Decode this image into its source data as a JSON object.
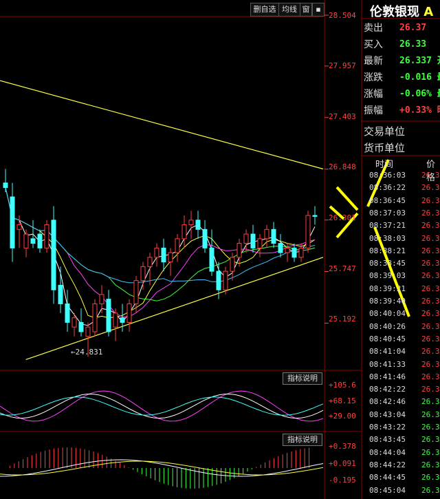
{
  "toolbar": {
    "delete_watch": "删自选",
    "ma_line": "均线",
    "window": "窗"
  },
  "title": "伦敦银现",
  "title_suffix": "A",
  "price_axis": [
    "28.504",
    "27.957",
    "27.403",
    "26.848",
    "26.301",
    "25.747",
    "25.192"
  ],
  "low_marker": "24.831",
  "indicator1": {
    "button": "指标说明",
    "levels": [
      "+105.6",
      "+68.15",
      "+29.00"
    ]
  },
  "indicator2": {
    "button": "指标说明",
    "levels": [
      "+0.378",
      "+0.091",
      "-0.195"
    ]
  },
  "quote": [
    {
      "label": "卖出",
      "value": "26.37",
      "color": "#ff4040"
    },
    {
      "label": "买入",
      "value": "26.33",
      "color": "#40ff40"
    },
    {
      "label": "最新",
      "value": "26.337 开",
      "color": "#40ff40"
    },
    {
      "label": "涨跌",
      "value": "-0.016 最",
      "color": "#40ff40"
    },
    {
      "label": "涨幅",
      "value": "-0.06% 最",
      "color": "#40ff40"
    },
    {
      "label": "振幅",
      "value": "+0.33% 昨",
      "color": "#ff4040"
    }
  ],
  "trade_unit_label": "交易单位",
  "currency_unit_label": "货币单位",
  "ticks_header": {
    "time": "时间",
    "price": "价格"
  },
  "ticks": [
    {
      "time": "08:36:03",
      "price": "26.3",
      "color": "#ff4040"
    },
    {
      "time": "08:36:22",
      "price": "26.3",
      "color": "#ff4040"
    },
    {
      "time": "08:36:45",
      "price": "26.3",
      "color": "#ff4040"
    },
    {
      "time": "08:37:03",
      "price": "26.3",
      "color": "#ff4040"
    },
    {
      "time": "08:37:21",
      "price": "26.3",
      "color": "#ff4040"
    },
    {
      "time": "08:38:03",
      "price": "26.3",
      "color": "#ff4040"
    },
    {
      "time": "08:38:21",
      "price": "26.3",
      "color": "#ff4040"
    },
    {
      "time": "08:38:45",
      "price": "26.3",
      "color": "#ff4040"
    },
    {
      "time": "08:39:03",
      "price": "26.3",
      "color": "#ff4040"
    },
    {
      "time": "08:39:21",
      "price": "26.3",
      "color": "#ff4040"
    },
    {
      "time": "08:39:40",
      "price": "26.3",
      "color": "#ff4040"
    },
    {
      "time": "08:40:04",
      "price": "26.3",
      "color": "#ff4040"
    },
    {
      "time": "08:40:26",
      "price": "26.3",
      "color": "#ff4040"
    },
    {
      "time": "08:40:45",
      "price": "26.3",
      "color": "#ff4040"
    },
    {
      "time": "08:41:04",
      "price": "26.3",
      "color": "#ff4040"
    },
    {
      "time": "08:41:33",
      "price": "26.3",
      "color": "#ff4040"
    },
    {
      "time": "08:41:46",
      "price": "26.3",
      "color": "#ff4040"
    },
    {
      "time": "08:42:22",
      "price": "26.3",
      "color": "#ff4040"
    },
    {
      "time": "08:42:46",
      "price": "26.3",
      "color": "#40ff40"
    },
    {
      "time": "08:43:04",
      "price": "26.3",
      "color": "#40ff40"
    },
    {
      "time": "08:43:22",
      "price": "26.3",
      "color": "#40ff40"
    },
    {
      "time": "08:43:45",
      "price": "26.3",
      "color": "#40ff40"
    },
    {
      "time": "08:44:04",
      "price": "26.3",
      "color": "#40ff40"
    },
    {
      "time": "08:44:22",
      "price": "26.3",
      "color": "#40ff40"
    },
    {
      "time": "08:44:45",
      "price": "26.3",
      "color": "#40ff40"
    },
    {
      "time": "08:45:04",
      "price": "26.3",
      "color": "#40ff40"
    }
  ],
  "chart_data": {
    "type": "candlestick",
    "ylim": [
      24.7,
      28.504
    ],
    "grid": false,
    "candles": [
      {
        "o": 26.7,
        "h": 26.85,
        "l": 26.6,
        "c": 26.65
      },
      {
        "o": 26.55,
        "h": 26.7,
        "l": 25.85,
        "c": 26.0
      },
      {
        "o": 26.2,
        "h": 26.35,
        "l": 26.0,
        "c": 26.25
      },
      {
        "o": 26.0,
        "h": 26.2,
        "l": 25.9,
        "c": 26.15
      },
      {
        "o": 26.1,
        "h": 26.3,
        "l": 26.0,
        "c": 26.05
      },
      {
        "o": 26.15,
        "h": 26.2,
        "l": 25.95,
        "c": 26.0
      },
      {
        "o": 26.0,
        "h": 26.3,
        "l": 25.95,
        "c": 26.25
      },
      {
        "o": 26.3,
        "h": 26.45,
        "l": 25.4,
        "c": 25.55
      },
      {
        "o": 25.6,
        "h": 25.8,
        "l": 25.3,
        "c": 25.4
      },
      {
        "o": 25.4,
        "h": 25.55,
        "l": 25.1,
        "c": 25.2
      },
      {
        "o": 25.15,
        "h": 25.3,
        "l": 25.05,
        "c": 25.25
      },
      {
        "o": 25.2,
        "h": 25.35,
        "l": 25.05,
        "c": 25.1
      },
      {
        "o": 25.05,
        "h": 25.2,
        "l": 24.83,
        "c": 25.15
      },
      {
        "o": 25.1,
        "h": 25.45,
        "l": 25.05,
        "c": 25.4
      },
      {
        "o": 25.4,
        "h": 25.6,
        "l": 25.3,
        "c": 25.5
      },
      {
        "o": 25.45,
        "h": 25.55,
        "l": 25.05,
        "c": 25.1
      },
      {
        "o": 25.15,
        "h": 25.35,
        "l": 25.0,
        "c": 25.3
      },
      {
        "o": 25.25,
        "h": 25.4,
        "l": 25.1,
        "c": 25.2
      },
      {
        "o": 25.2,
        "h": 25.45,
        "l": 25.1,
        "c": 25.4
      },
      {
        "o": 25.4,
        "h": 25.7,
        "l": 25.3,
        "c": 25.65
      },
      {
        "o": 25.65,
        "h": 25.85,
        "l": 25.55,
        "c": 25.8
      },
      {
        "o": 25.8,
        "h": 25.95,
        "l": 25.6,
        "c": 25.9
      },
      {
        "o": 25.9,
        "h": 26.05,
        "l": 25.8,
        "c": 26.0
      },
      {
        "o": 26.0,
        "h": 26.1,
        "l": 25.75,
        "c": 25.85
      },
      {
        "o": 25.85,
        "h": 26.0,
        "l": 25.7,
        "c": 25.95
      },
      {
        "o": 25.95,
        "h": 26.15,
        "l": 25.85,
        "c": 26.1
      },
      {
        "o": 26.1,
        "h": 26.35,
        "l": 26.0,
        "c": 26.25
      },
      {
        "o": 26.25,
        "h": 26.4,
        "l": 26.1,
        "c": 26.3
      },
      {
        "o": 26.3,
        "h": 26.4,
        "l": 26.1,
        "c": 26.2
      },
      {
        "o": 26.2,
        "h": 26.3,
        "l": 25.95,
        "c": 26.0
      },
      {
        "o": 26.0,
        "h": 26.2,
        "l": 25.7,
        "c": 25.75
      },
      {
        "o": 25.75,
        "h": 25.85,
        "l": 25.45,
        "c": 25.55
      },
      {
        "o": 25.55,
        "h": 25.8,
        "l": 25.5,
        "c": 25.75
      },
      {
        "o": 25.75,
        "h": 25.95,
        "l": 25.65,
        "c": 25.9
      },
      {
        "o": 25.9,
        "h": 26.1,
        "l": 25.8,
        "c": 26.05
      },
      {
        "o": 26.05,
        "h": 26.2,
        "l": 25.95,
        "c": 26.15
      },
      {
        "o": 26.15,
        "h": 26.25,
        "l": 25.95,
        "c": 26.0
      },
      {
        "o": 26.0,
        "h": 26.15,
        "l": 25.9,
        "c": 26.1
      },
      {
        "o": 26.1,
        "h": 26.25,
        "l": 26.0,
        "c": 26.2
      },
      {
        "o": 26.2,
        "h": 26.28,
        "l": 26.0,
        "c": 26.05
      },
      {
        "o": 26.05,
        "h": 26.15,
        "l": 25.9,
        "c": 25.95
      },
      {
        "o": 25.95,
        "h": 26.05,
        "l": 25.85,
        "c": 26.0
      },
      {
        "o": 26.0,
        "h": 26.05,
        "l": 25.85,
        "c": 25.9
      },
      {
        "o": 25.9,
        "h": 26.05,
        "l": 25.85,
        "c": 26.0
      },
      {
        "o": 26.0,
        "h": 26.4,
        "l": 25.95,
        "c": 26.35
      },
      {
        "o": 26.35,
        "h": 26.45,
        "l": 26.25,
        "c": 26.34
      }
    ],
    "trendlines": [
      {
        "x0": 0,
        "y0": 27.8,
        "x1": 1,
        "y1": 26.85,
        "color": "#ffff40"
      },
      {
        "x0": 0.08,
        "y0": 24.8,
        "x1": 1,
        "y1": 25.9,
        "color": "#ffff40"
      }
    ]
  }
}
